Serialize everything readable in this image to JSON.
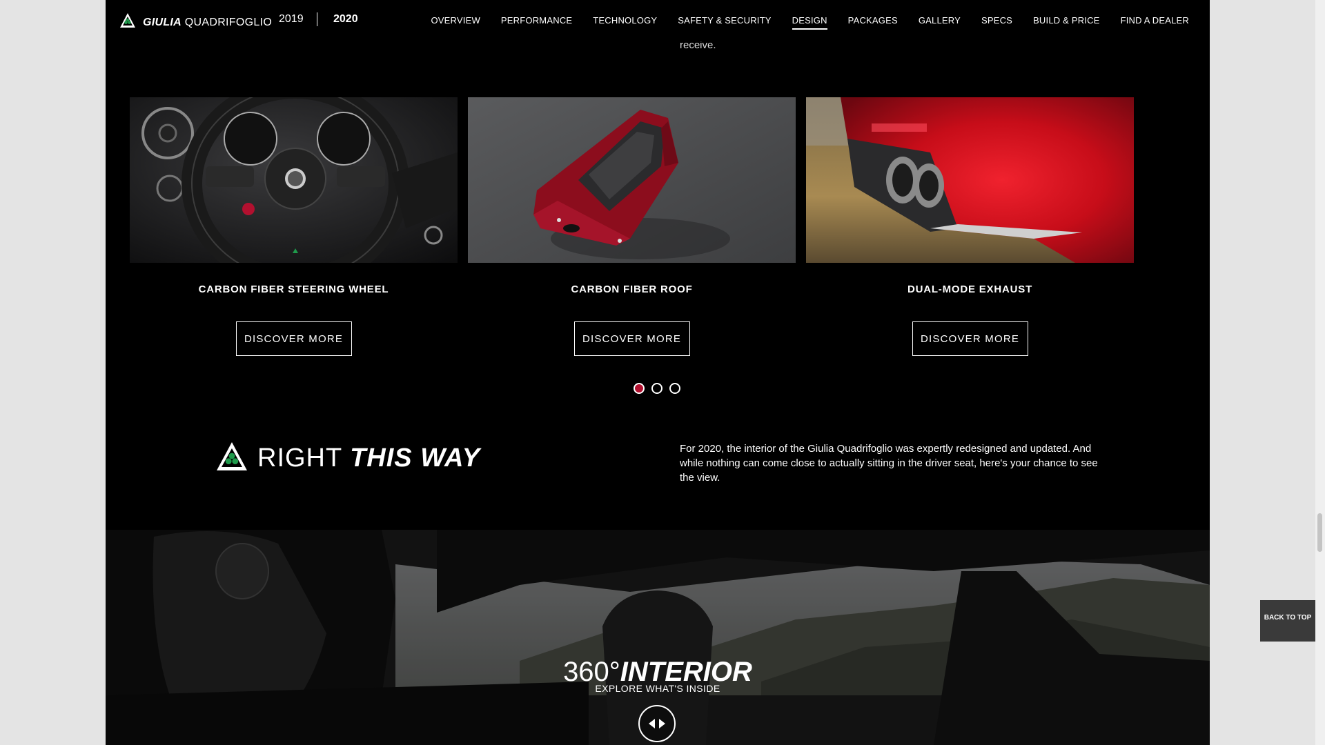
{
  "nav": {
    "brand_bold": "GIULIA",
    "brand_rest": "QUADRIFOGLIO",
    "year_2019": "2019",
    "year_2020": "2020",
    "selected_year": "2020",
    "menu": [
      {
        "label": "OVERVIEW",
        "active": false
      },
      {
        "label": "PERFORMANCE",
        "active": false
      },
      {
        "label": "TECHNOLOGY",
        "active": false
      },
      {
        "label": "SAFETY & SECURITY",
        "active": false
      },
      {
        "label": "DESIGN",
        "active": true
      },
      {
        "label": "PACKAGES",
        "active": false
      },
      {
        "label": "GALLERY",
        "active": false
      },
      {
        "label": "SPECS",
        "active": false
      },
      {
        "label": "BUILD & PRICE",
        "active": false
      },
      {
        "label": "FIND A DEALER",
        "active": false
      }
    ]
  },
  "intro_tail": "receive.",
  "cards": [
    {
      "title": "CARBON FIBER STEERING WHEEL",
      "button": "DISCOVER MORE",
      "image": "steering-wheel"
    },
    {
      "title": "CARBON FIBER ROOF",
      "button": "DISCOVER MORE",
      "image": "red-car-roof"
    },
    {
      "title": "DUAL-MODE EXHAUST",
      "button": "DISCOVER MORE",
      "image": "exhaust"
    }
  ],
  "carousel": {
    "pages": 3,
    "active_index": 0
  },
  "right_this_way": {
    "title_light": "RIGHT",
    "title_bold": "THIS WAY",
    "text": "For 2020, the interior of the Giulia Quadrifoglio was expertly redesigned and updated. And while nothing can come close to actually sitting in the driver seat, here's your chance to see the view."
  },
  "interior": {
    "title_light": "360°",
    "title_bold": "INTERIOR",
    "subtitle": "EXPLORE WHAT'S INSIDE"
  },
  "back_to_top": "BACK TO TOP",
  "colors": {
    "accent_red": "#b2102f",
    "background": "#000000",
    "quadrifoglio_green": "#1f9a4b"
  }
}
